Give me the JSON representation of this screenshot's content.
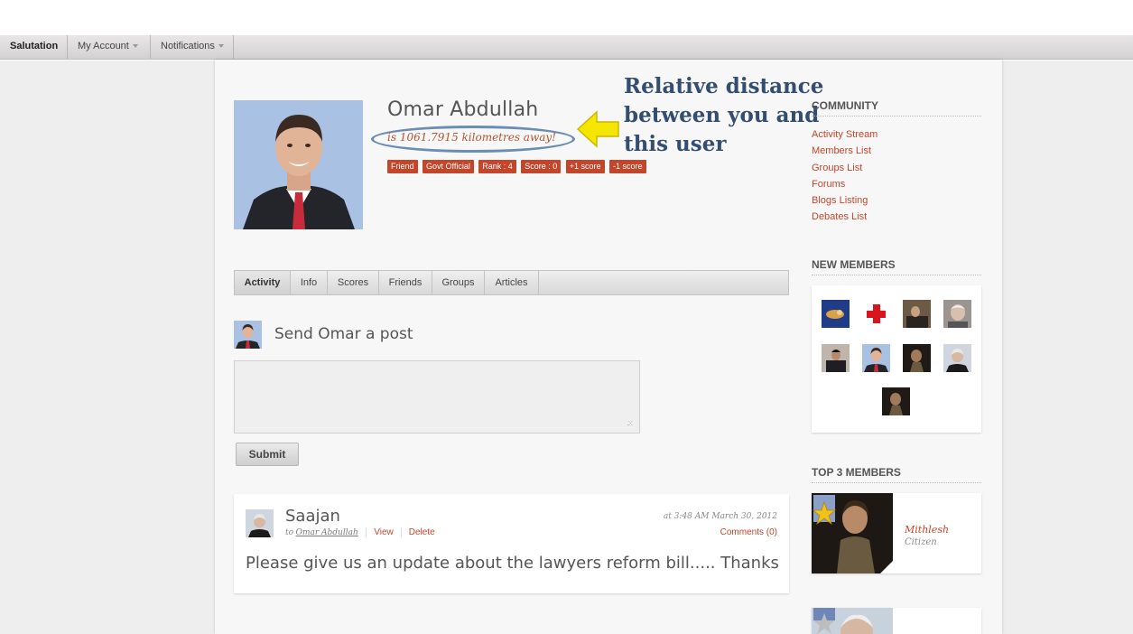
{
  "menubar": {
    "items": [
      "Salutation",
      "My Account",
      "Notifications"
    ]
  },
  "profile": {
    "name": "Omar Abdullah",
    "distance": "is 1061.7915 kilometres away!",
    "badges": [
      "Friend",
      "Govt Official",
      "Rank : 4",
      "Score : 0",
      "+1 score",
      "-1 score"
    ]
  },
  "annotation": {
    "text": "Relative distance between you and this user"
  },
  "tabs": [
    "Activity",
    "Info",
    "Scores",
    "Friends",
    "Groups",
    "Articles"
  ],
  "post_form": {
    "title": "Send Omar a post",
    "submit_label": "Submit"
  },
  "feed": {
    "author": "Saajan",
    "to_prefix": "to",
    "to_user": "Omar Abdullah",
    "view_label": "View",
    "delete_label": "Delete",
    "timestamp": "at 3:48 AM March 30, 2012",
    "comments_label": "Comments (0)",
    "body": "Please give us an update about the lawyers reform bill..... Thanks"
  },
  "sidebar": {
    "community_heading": "COMMUNITY",
    "community_links": [
      "Activity Stream",
      "Members List",
      "Groups List",
      "Forums",
      "Blogs Listing",
      "Debates List"
    ],
    "new_members_heading": "NEW MEMBERS",
    "top_members_heading": "TOP 3 MEMBERS",
    "top_member": {
      "name": "Mithlesh",
      "role": "Citizen"
    }
  },
  "colors": {
    "accent": "#c5452a",
    "annotation": "#344e72",
    "ellipse": "#6a8db4",
    "arrow": "#f5e600"
  }
}
